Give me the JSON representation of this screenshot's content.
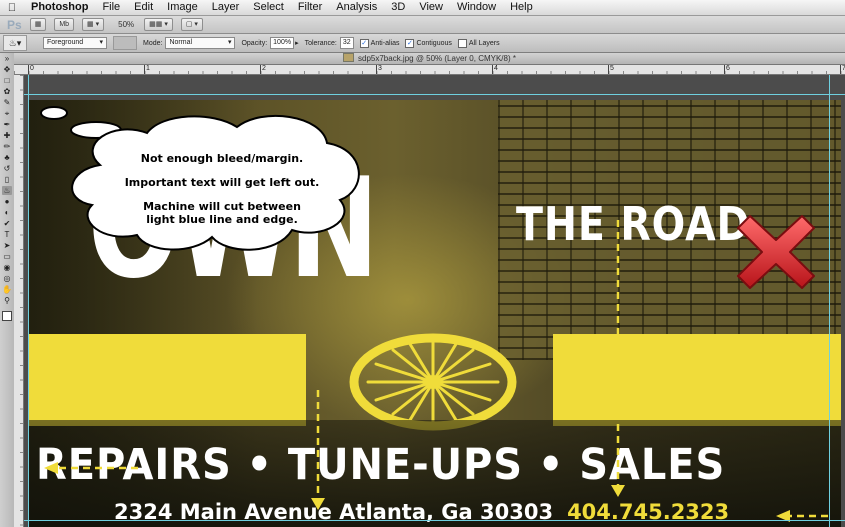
{
  "menubar": {
    "app": "Photoshop",
    "items": [
      "File",
      "Edit",
      "Image",
      "Layer",
      "Select",
      "Filter",
      "Analysis",
      "3D",
      "View",
      "Window",
      "Help"
    ]
  },
  "appbar": {
    "logo": "Ps",
    "mb_label": "Mb",
    "zoom": "50%"
  },
  "options": {
    "fill_source": "Foreground",
    "mode_label": "Mode:",
    "mode_value": "Normal",
    "opacity_label": "Opacity:",
    "opacity_value": "100%",
    "tolerance_label": "Tolerance:",
    "tolerance_value": "32",
    "antialias_label": "Anti-alias",
    "contiguous_label": "Contiguous",
    "all_layers_label": "All Layers"
  },
  "document": {
    "title": "sdp5x7back.jpg @ 50% (Layer 0, CMYK/8) *"
  },
  "ruler": {
    "ticks": [
      "0",
      "1",
      "2",
      "3",
      "4",
      "5",
      "6",
      "7"
    ]
  },
  "artwork": {
    "title_big": "OWN",
    "title_small": "THE ROAD",
    "services": "REPAIRS • TUNE-UPS • SALES",
    "street": "2324 Main Avenue Atlanta, Ga 30303",
    "phone": "404.745.2323"
  },
  "annotation": {
    "line1": "Not enough bleed/margin.",
    "line2": "Important text will get left out.",
    "line3": "Machine will cut between",
    "line4": "light blue line and edge."
  },
  "colors": {
    "accent_yellow": "#f0dc3a",
    "guide": "#6fd0e0",
    "x_red": "#d8262b"
  }
}
